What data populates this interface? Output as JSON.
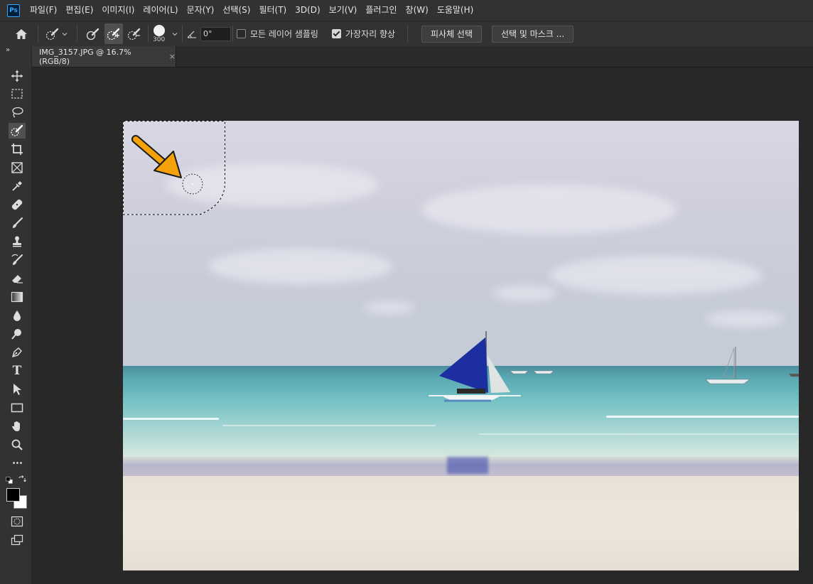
{
  "app": {
    "logo": "Ps"
  },
  "menu": [
    "파일(F)",
    "편집(E)",
    "이미지(I)",
    "레이어(L)",
    "문자(Y)",
    "선택(S)",
    "필터(T)",
    "3D(D)",
    "보기(V)",
    "플러그인",
    "창(W)",
    "도움말(H)"
  ],
  "options": {
    "brush_size": "300",
    "angle": "0°",
    "sample_all_layers": {
      "label": "모든 레이어 샘플링",
      "checked": false
    },
    "enhance_edge": {
      "label": "가장자리 향상",
      "checked": true
    },
    "select_subject": "피사체 선택",
    "select_and_mask": "선택 및 마스크 ..."
  },
  "document_tab": {
    "title": "IMG_3157.JPG @ 16.7% (RGB/8)",
    "close": "×"
  },
  "toolbar": {
    "collapse": "»",
    "tools": [
      "move-tool",
      "marquee-tool",
      "lasso-tool",
      "quick-selection-tool",
      "crop-tool",
      "frame-tool",
      "eyedropper-tool",
      "healing-brush-tool",
      "brush-tool",
      "clone-stamp-tool",
      "history-brush-tool",
      "eraser-tool",
      "gradient-tool",
      "blur-tool",
      "dodge-tool",
      "pen-tool",
      "type-tool",
      "path-selection-tool",
      "rectangle-tool",
      "hand-tool",
      "zoom-tool",
      "more-tools"
    ],
    "active_tool": "quick-selection-tool",
    "type_glyph": "T",
    "more_glyph": "•••"
  },
  "colors": {
    "accent": "#31a8ff",
    "annotation_arrow": "#f5a20a",
    "sail": "#1d2fa0",
    "foreground": "#000000",
    "background": "#ffffff"
  }
}
